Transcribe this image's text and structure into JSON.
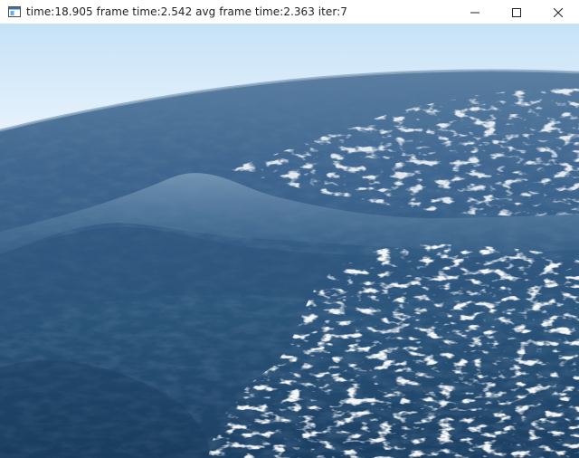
{
  "window": {
    "title": "time:18.905 frame time:2.542 avg frame time:2.363 iter:7",
    "app_icon": "app-window-icon",
    "controls": {
      "minimize_icon": "minimize-icon",
      "maximize_icon": "maximize-icon",
      "close_icon": "close-icon"
    }
  },
  "scene": {
    "description_type": "ocean-render",
    "sky_top_color": "#c9e4f8",
    "sky_horizon_color": "#e8f3fc",
    "ocean_far_color": "#4d7296",
    "ocean_mid_color": "#3a6288",
    "ocean_near_color": "#1e4466",
    "highlight_color": "#ffffff"
  }
}
